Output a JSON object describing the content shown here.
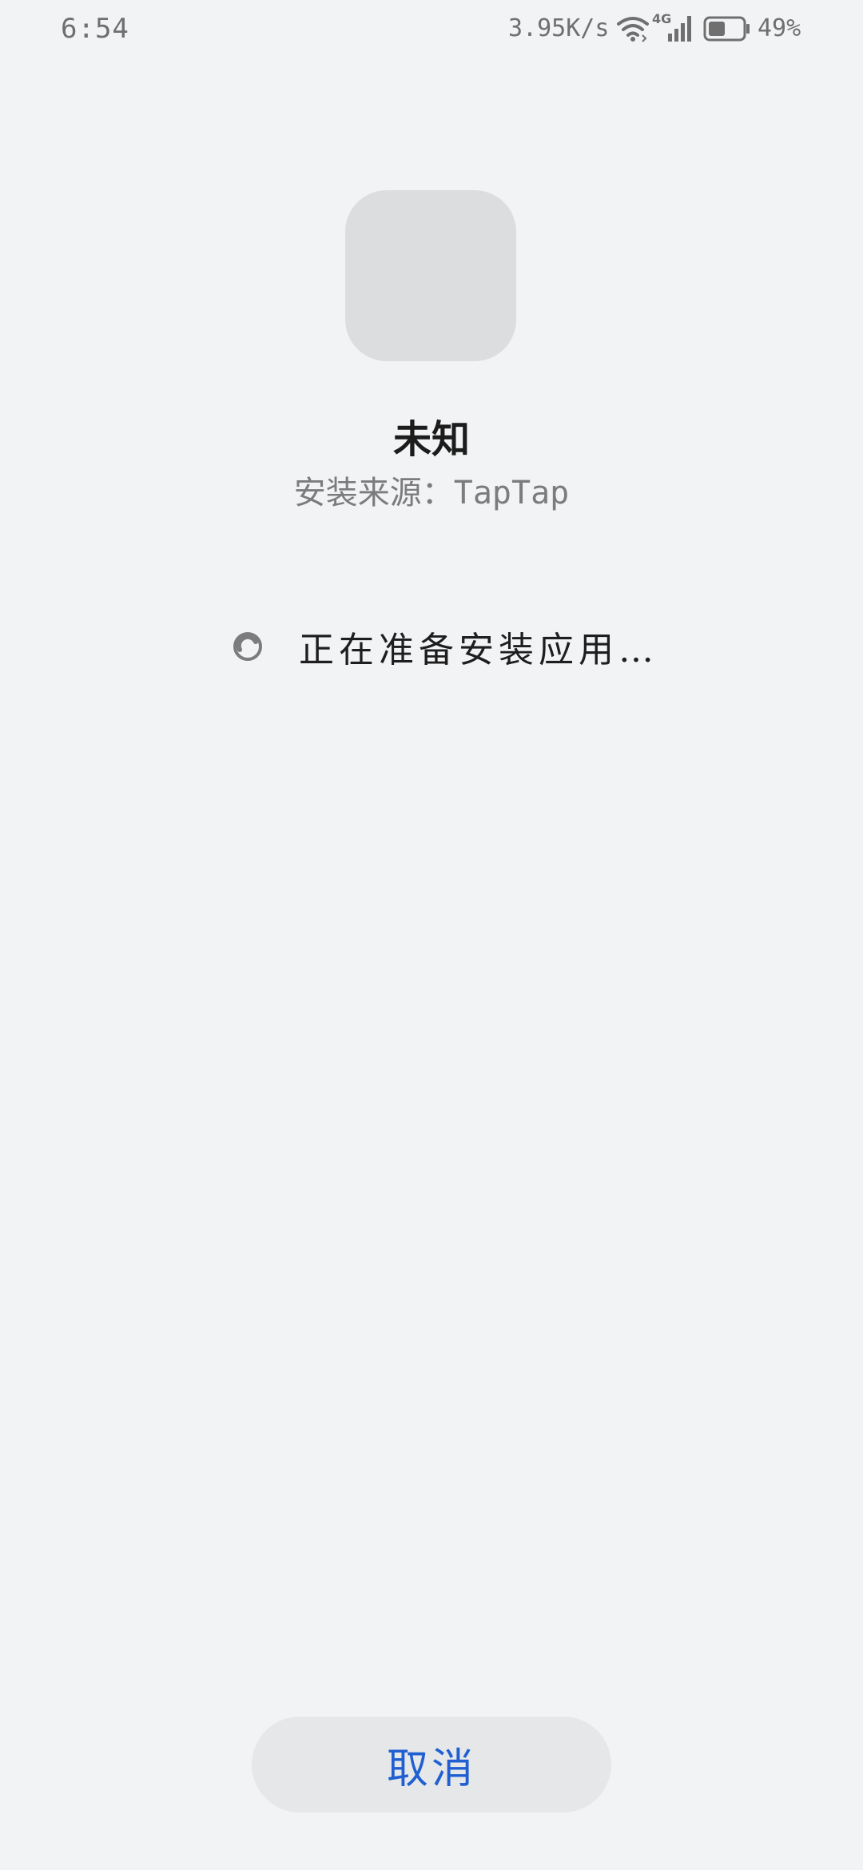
{
  "status_bar": {
    "time": "6:54",
    "net_speed": "3.95K/s",
    "network_type": "4G",
    "battery_percent": "49%",
    "battery_level": 0.49,
    "icons": [
      "wifi-icon",
      "signal-icon",
      "battery-icon"
    ]
  },
  "app": {
    "icon": "app-icon-placeholder",
    "name": "未知",
    "source": "安装来源：TapTap"
  },
  "progress": {
    "message": "正在准备安装应用…",
    "icon": "loading-spinner-icon"
  },
  "actions": {
    "cancel_label": "取消"
  },
  "colors": {
    "background": "#F2F3F5",
    "accent": "#1F5FD1",
    "button_bg": "#E6E7E9",
    "icon_placeholder": "#DCDDDF"
  }
}
